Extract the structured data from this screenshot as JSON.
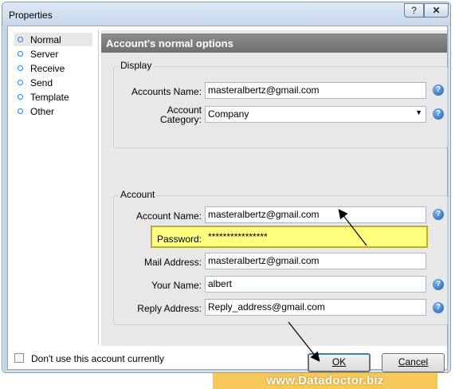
{
  "window": {
    "title": "Properties",
    "help_glyph": "?",
    "close_glyph": "✕"
  },
  "nav": {
    "items": [
      {
        "label": "Normal"
      },
      {
        "label": "Server"
      },
      {
        "label": "Receive"
      },
      {
        "label": "Send"
      },
      {
        "label": "Template"
      },
      {
        "label": "Other"
      }
    ],
    "selected": "Normal"
  },
  "panel": {
    "header": "Account's normal options",
    "display": {
      "title": "Display",
      "accounts_name_label": "Accounts Name:",
      "accounts_name_value": "masteralbertz@gmail.com",
      "category_label_line1": "Account",
      "category_label_line2": "Category:",
      "category_value": "Company"
    },
    "account": {
      "title": "Account",
      "account_name_label": "Account Name:",
      "account_name_value": "masteralbertz@gmail.com",
      "password_label": "Password:",
      "password_value": "****************",
      "mail_address_label": "Mail Address:",
      "mail_address_value": "masteralbertz@gmail.com",
      "your_name_label": "Your Name:",
      "your_name_value": "albert",
      "reply_address_label": "Reply Address:",
      "reply_address_value": "Reply_address@gmail.com"
    }
  },
  "footer": {
    "dont_use_label": "Don't use this account currently",
    "dont_use_checked": false,
    "ok_label": "OK",
    "cancel_label": "Cancel"
  },
  "banner": {
    "text": "www.Datadoctor.biz"
  },
  "colors": {
    "highlight": "#ffff80",
    "panel_header": "#7d7d7d",
    "banner": "#f6c95a",
    "help_icon": "#2f6fc4"
  }
}
